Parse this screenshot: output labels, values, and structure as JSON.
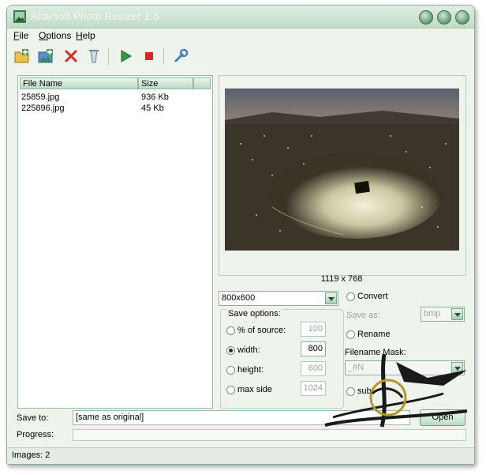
{
  "window": {
    "title": "Altarsoft Photo Resizer 1.5"
  },
  "menu": {
    "file": {
      "u": "F",
      "rest": "ile"
    },
    "options": {
      "u": "O",
      "rest": "ptions"
    },
    "help": {
      "u": "H",
      "rest": "elp"
    }
  },
  "toolbar": {
    "icons": [
      "add-files-icon",
      "add-folder-icon",
      "remove-icon",
      "clear-icon",
      "start-icon",
      "stop-icon",
      "settings-icon"
    ]
  },
  "files": {
    "columns": [
      "File Name",
      "Size"
    ],
    "rows": [
      {
        "name": "25859.jpg",
        "size": "936 Kb"
      },
      {
        "name": "225896.jpg",
        "size": "45 Kb"
      }
    ]
  },
  "preview": {
    "dimensions": "1119 x 768"
  },
  "size_preset": "800x600",
  "save_options": {
    "label": "Save options:",
    "percent": {
      "label": "% of source:",
      "value": "100"
    },
    "width": {
      "label": "width:",
      "value": "800"
    },
    "height": {
      "label": "height:",
      "value": "600"
    },
    "max_side": {
      "label": "max side",
      "value": "1024"
    }
  },
  "convert": {
    "label": "Convert",
    "save_as_label": "Save as:",
    "format": "bmp"
  },
  "rename": {
    "label": "Rename",
    "mask_label": "Filename Mask:",
    "mask": "_#N"
  },
  "subfolders": {
    "label": "sub"
  },
  "save_to": {
    "label": "Save to:",
    "value": "[same as original]",
    "open_label": "Open"
  },
  "progress": {
    "label": "Progress:",
    "value": 0
  },
  "status": {
    "text": "Images: 2"
  },
  "colors": {
    "accent": "#5f9a73",
    "window_bg": "#eef3ec",
    "header": "#b8dbc1"
  }
}
